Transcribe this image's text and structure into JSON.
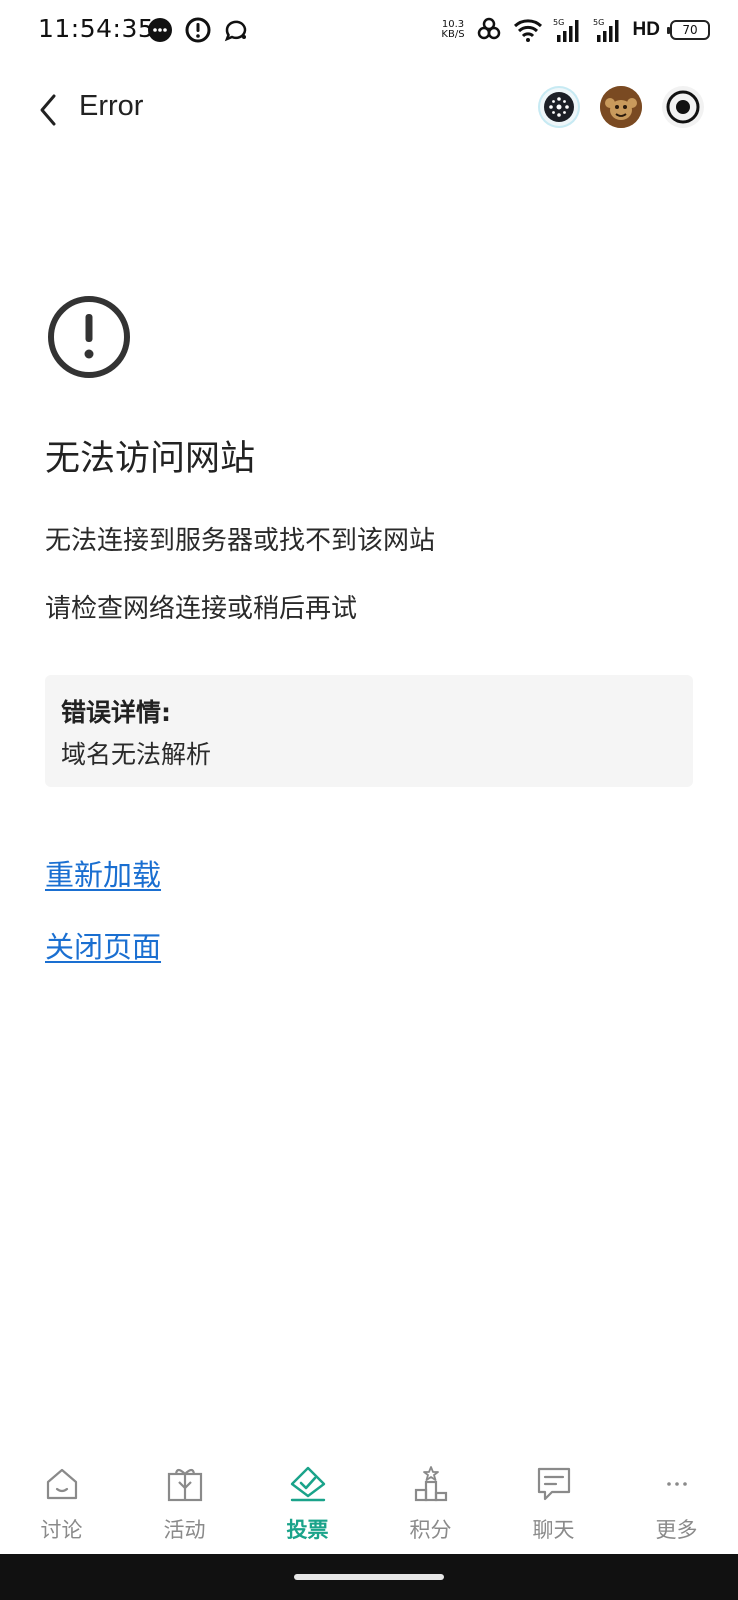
{
  "status_bar": {
    "time": "11:54:35",
    "net_speed_value": "10.3",
    "net_speed_unit": "KB/S",
    "sim1_label": "5G",
    "sim2_label": "5G",
    "hd_label": "HD",
    "battery": "70"
  },
  "header": {
    "title": "Error"
  },
  "error": {
    "title": "无法访问网站",
    "message_1": "无法连接到服务器或找不到该网站",
    "message_2": "请检查网络连接或稍后再试",
    "details_label": "错误详情:",
    "details_value": "域名无法解析",
    "reload_link": "重新加载",
    "close_link": "关闭页面"
  },
  "tabs": [
    {
      "label": "讨论",
      "icon": "house-icon",
      "active": false
    },
    {
      "label": "活动",
      "icon": "gift-icon",
      "active": false
    },
    {
      "label": "投票",
      "icon": "vote-check-icon",
      "active": true
    },
    {
      "label": "积分",
      "icon": "podium-icon",
      "active": false
    },
    {
      "label": "聊天",
      "icon": "chat-icon",
      "active": false
    },
    {
      "label": "更多",
      "icon": "more-dots-icon",
      "active": false
    }
  ],
  "colors": {
    "accent_tab": "#1aa38a",
    "link": "#1a6fd1",
    "details_bg": "#f5f5f5"
  }
}
